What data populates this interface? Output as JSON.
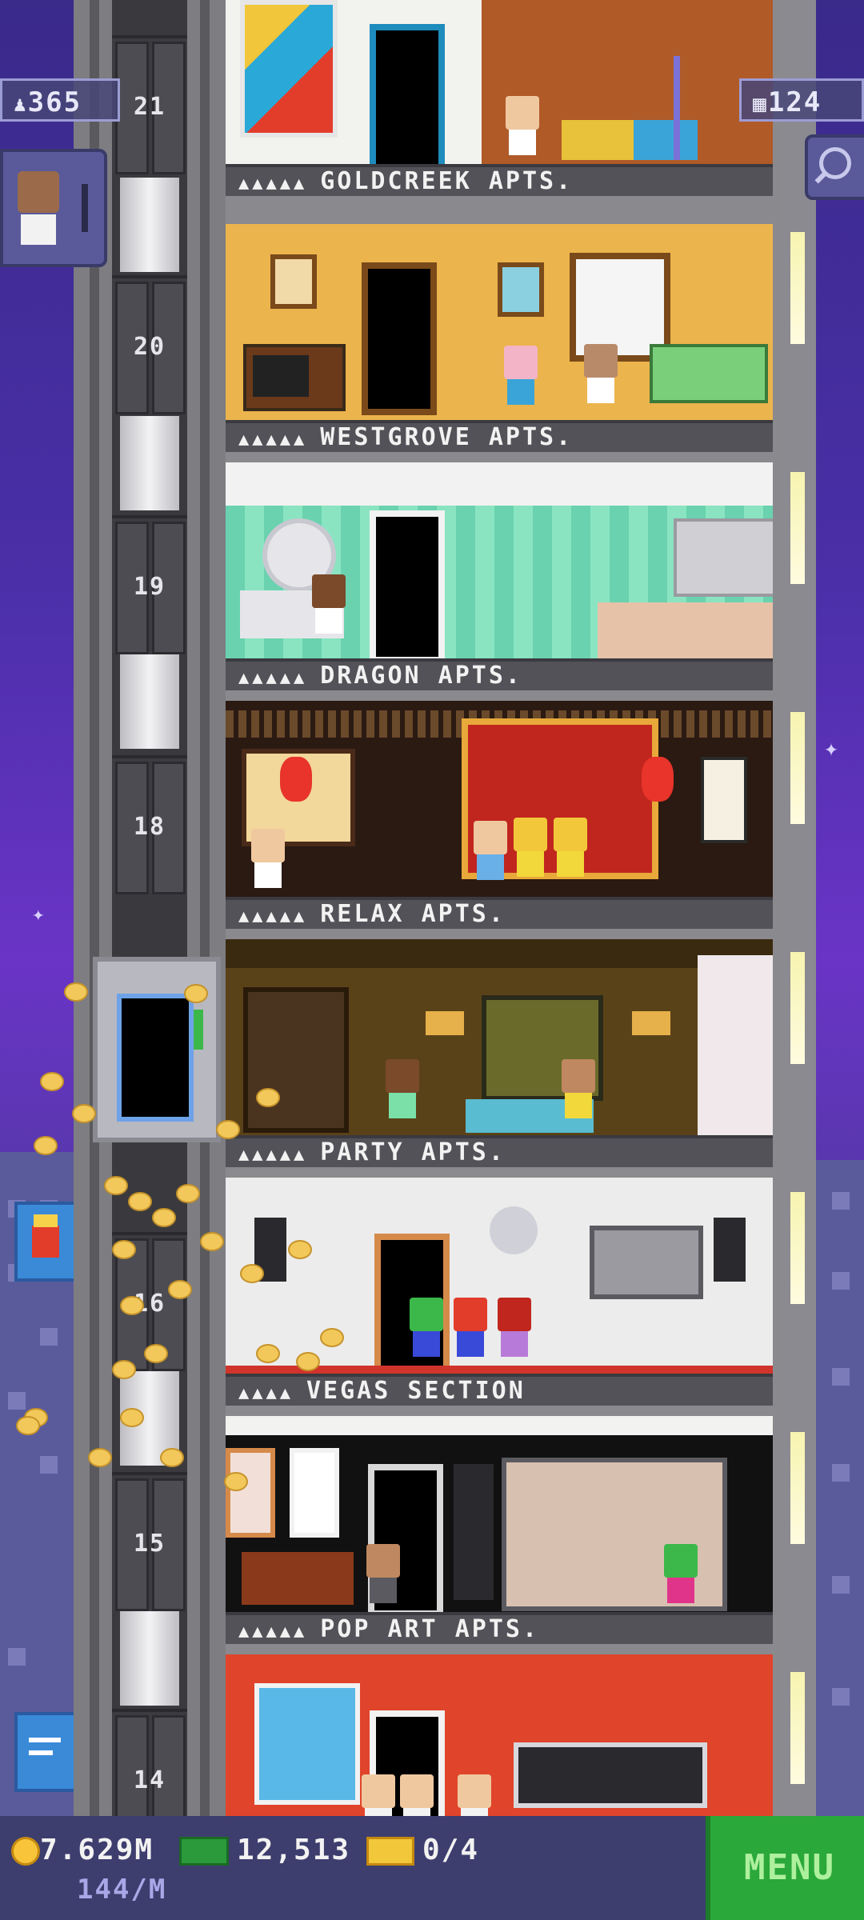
{
  "hud": {
    "population": "365",
    "floors_count": "124",
    "coins": "7.629M",
    "coins_rate": "144/M",
    "bux": "12,513",
    "tickets": "0/4",
    "menu_label": "MENU"
  },
  "elevator": {
    "floor_numbers": [
      "21",
      "20",
      "19",
      "18",
      "16",
      "15",
      "14"
    ]
  },
  "floors": [
    {
      "name": "GOLDCREEK APTS.",
      "stars": "▲▲▲▲▲"
    },
    {
      "name": "WESTGROVE APTS.",
      "stars": "▲▲▲▲▲"
    },
    {
      "name": "DRAGON APTS.",
      "stars": "▲▲▲▲▲"
    },
    {
      "name": "RELAX APTS.",
      "stars": "▲▲▲▲▲"
    },
    {
      "name": "PARTY APTS.",
      "stars": "▲▲▲▲▲"
    },
    {
      "name": "VEGAS SECTION",
      "stars": "▲▲▲▲"
    },
    {
      "name": "POP ART APTS.",
      "stars": "▲▲▲▲▲"
    }
  ],
  "colors": {
    "menu_green": "#2aa83a",
    "hud_bg": "#3d3d6e",
    "coin": "#f7c43a"
  }
}
